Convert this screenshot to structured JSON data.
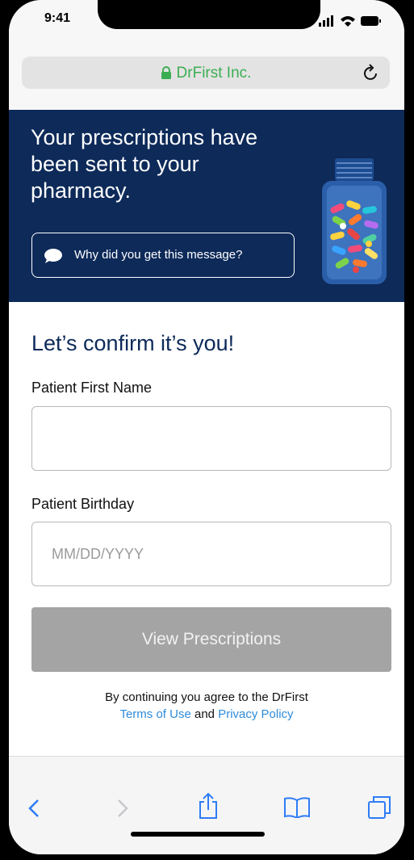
{
  "status": {
    "time": "9:41"
  },
  "browser": {
    "url_label": "DrFirst Inc."
  },
  "banner": {
    "headline": "Your prescriptions have been sent to your pharmacy.",
    "why_label": "Why did you get this message?"
  },
  "form": {
    "heading": "Let’s confirm it’s you!",
    "first_name_label": "Patient First Name",
    "first_name_value": "",
    "birthday_label": "Patient Birthday",
    "birthday_placeholder": "MM/DD/YYYY",
    "submit_label": "View Prescriptions"
  },
  "legal": {
    "line1": "By continuing you agree to the DrFirst",
    "terms": "Terms of Use",
    "and": "and",
    "privacy": "Privacy Policy"
  },
  "toolbar": {
    "items": [
      "back-icon",
      "forward-icon",
      "share-icon",
      "bookmarks-icon",
      "tabs-icon"
    ]
  },
  "colors": {
    "banner": "#0d2a59",
    "accent": "#3cae52",
    "link": "#2e8bd9",
    "button_disabled": "#a4a4a4"
  }
}
